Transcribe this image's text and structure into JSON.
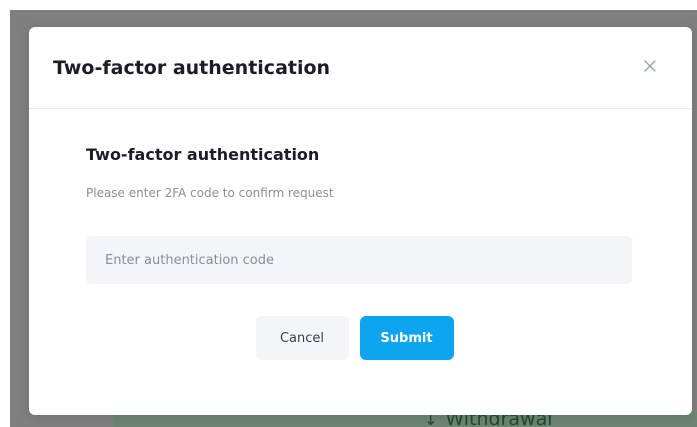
{
  "background": {
    "action_label": "Withdrawal",
    "action_icon": "arrow-down-icon",
    "accent_color": "#6c8572"
  },
  "modal": {
    "title": "Two-factor authentication",
    "close_icon": "close-icon",
    "body": {
      "heading": "Two-factor authentication",
      "subtitle": "Please enter 2FA code to confirm request",
      "code_input": {
        "value": "",
        "placeholder": "Enter authentication code"
      }
    },
    "buttons": {
      "cancel_label": "Cancel",
      "submit_label": "Submit"
    },
    "colors": {
      "submit": "#0ea5f0",
      "input_bg": "#f3f5f8",
      "title": "#1d1d29",
      "muted": "#8a8f98"
    }
  }
}
